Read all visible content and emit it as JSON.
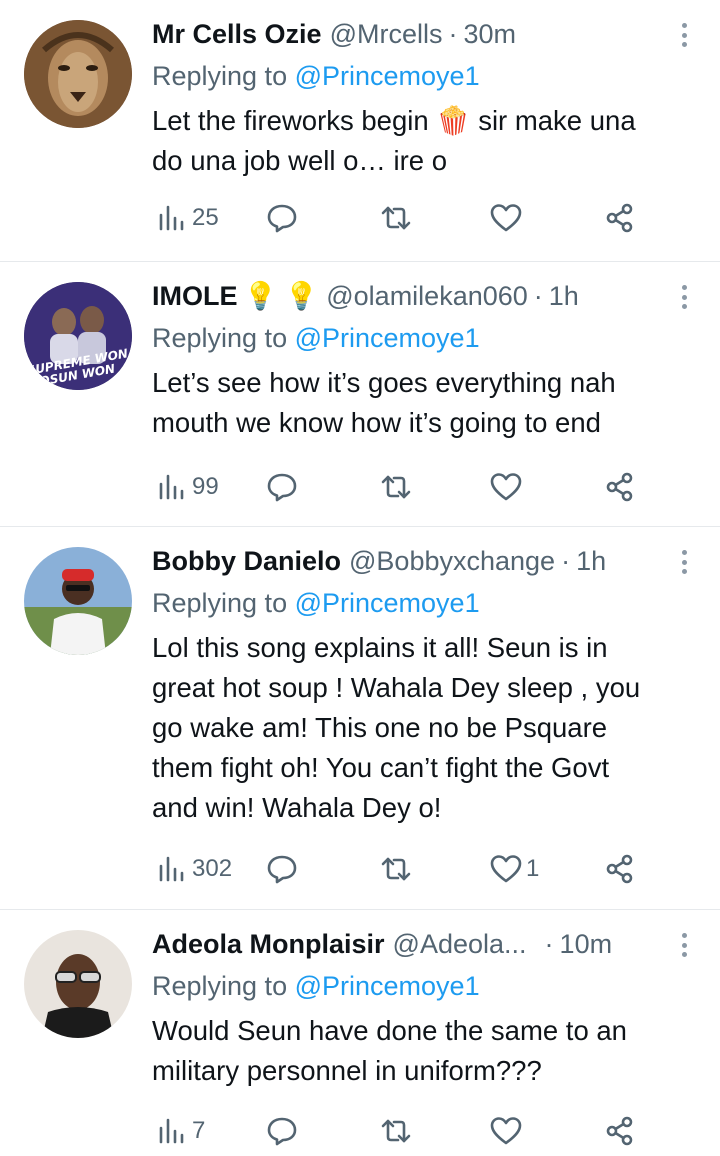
{
  "replying_prefix": "Replying to",
  "tweets": [
    {
      "name": "Mr Cells Ozie",
      "handle": "@Mrcells",
      "time": "30m",
      "reply_to": "@Princemoye1",
      "text": "Let the fireworks begin 🍿 sir make una\ndo una job well o… ire o",
      "views": "25",
      "likes": "",
      "avatar": "lion-avatar"
    },
    {
      "name": "IMOLE",
      "name_emoji": "💡 💡",
      "handle": "@olamilekan060",
      "time": "1h",
      "reply_to": "@Princemoye1",
      "text": "Let’s see how it’s goes everything nah\nmouth we know how it’s going to end",
      "views": "99",
      "likes": "",
      "avatar": "campaign-avatar",
      "avatar_text_1": "SUPREME WON",
      "avatar_text_2": "OSUN WON"
    },
    {
      "name": "Bobby Danielo",
      "handle": "@Bobbyxchange",
      "time": "1h",
      "reply_to": "@Princemoye1",
      "text": "Lol this song explains it all! Seun is in\ngreat hot soup ! Wahala Dey sleep , you\ngo wake am! This one no be Psquare\nthem fight oh! You can’t fight the Govt\nand win! Wahala Dey o!",
      "views": "302",
      "likes": "1",
      "avatar": "person-avatar"
    },
    {
      "name": "Adeola Monplaisir",
      "handle": "@Adeola...",
      "time": "10m",
      "reply_to": "@Princemoye1",
      "text": "Would Seun have done the same to an\nmilitary personnel in uniform???",
      "views": "7",
      "likes": "",
      "avatar": "person-sunglasses-avatar"
    }
  ],
  "colors": {
    "text": "#0f1419",
    "secondary": "#536471",
    "link": "#1d9bf0",
    "divider": "#e6e9ec"
  }
}
